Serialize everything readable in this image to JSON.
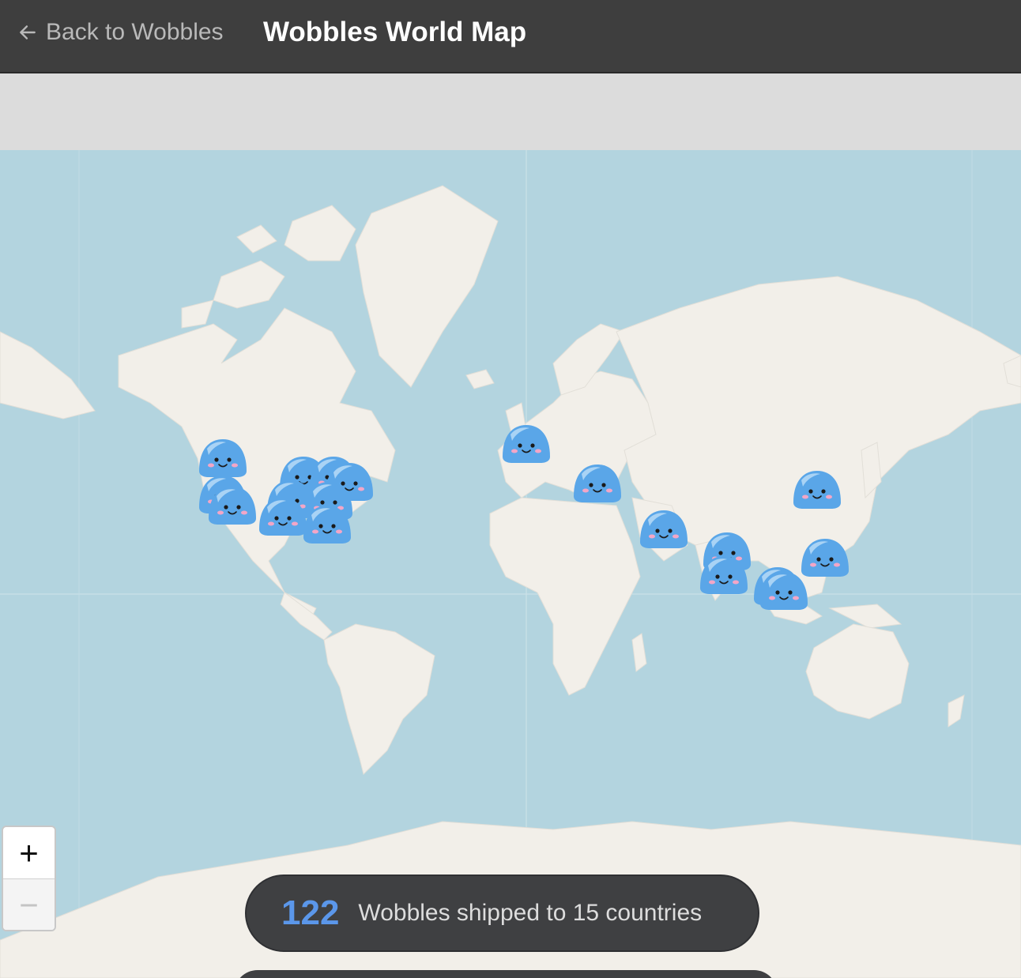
{
  "header": {
    "back_label": "Back to Wobbles",
    "title": "Wobbles World Map"
  },
  "zoom": {
    "in_label": "+",
    "out_label": "−"
  },
  "stats": {
    "count": "122",
    "label": "Wobbles shipped to 15 countries"
  },
  "colors": {
    "header_bg": "#3e3e3e",
    "ocean": "#b3d4df",
    "land": "#f2efe9",
    "count_accent": "#5b97ea",
    "marker": "#5aa6e8"
  },
  "icons": {
    "back": "arrow-left-icon",
    "marker": "wobble-blob-icon"
  }
}
